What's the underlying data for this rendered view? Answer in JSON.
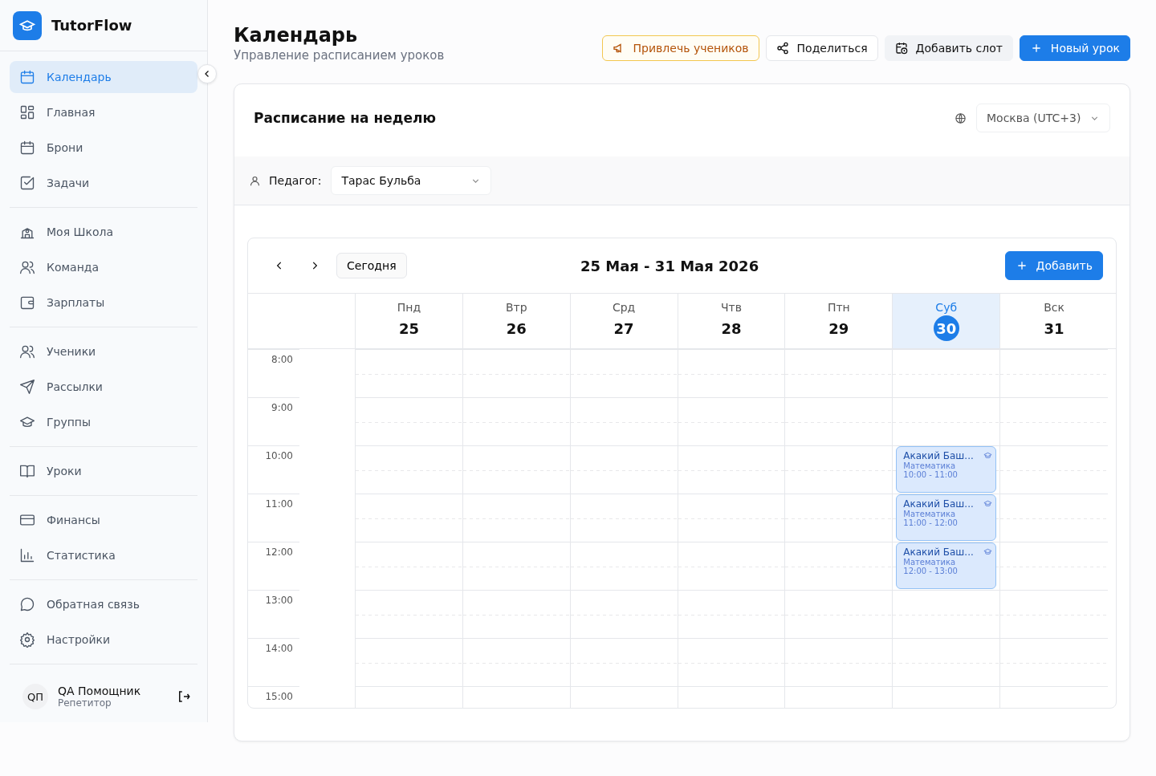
{
  "brand": {
    "name": "TutorFlow"
  },
  "sidebar": {
    "groups": [
      [
        {
          "label": "Календарь",
          "selected": true
        },
        {
          "label": "Главная",
          "selected": false
        },
        {
          "label": "Брони",
          "selected": false
        },
        {
          "label": "Задачи",
          "selected": false
        }
      ],
      [
        {
          "label": "Моя Школа",
          "selected": false
        },
        {
          "label": "Команда",
          "selected": false
        },
        {
          "label": "Зарплаты",
          "selected": false
        }
      ],
      [
        {
          "label": "Ученики",
          "selected": false
        },
        {
          "label": "Рассылки",
          "selected": false
        },
        {
          "label": "Группы",
          "selected": false
        }
      ],
      [
        {
          "label": "Уроки",
          "selected": false
        }
      ],
      [
        {
          "label": "Финансы",
          "selected": false
        },
        {
          "label": "Статистика",
          "selected": false
        }
      ],
      [
        {
          "label": "Обратная связь",
          "selected": false
        },
        {
          "label": "Настройки",
          "selected": false
        }
      ]
    ],
    "user": {
      "initials": "QП",
      "name": "QA Помощник",
      "role": "Репетитор"
    }
  },
  "header": {
    "title": "Календарь",
    "subtitle": "Управление расписанием уроков",
    "actions": [
      {
        "label": "Привлечь учеников",
        "kind": "promo"
      },
      {
        "label": "Поделиться",
        "kind": "share"
      },
      {
        "label": "Добавить слот",
        "kind": "slot"
      },
      {
        "label": "Новый урок",
        "kind": "primary"
      }
    ]
  },
  "schedule": {
    "title": "Расписание на неделю",
    "timezone": "Москва (UTC+3)",
    "teacher_label": "Педагог:",
    "teacher": "Тарас Бульба",
    "today_button": "Сегодня",
    "range": "25 Мая - 31 Мая 2026",
    "add_button": "Добавить",
    "days": [
      {
        "name": "Пнд",
        "date": "25",
        "selected": false
      },
      {
        "name": "Втр",
        "date": "26",
        "selected": false
      },
      {
        "name": "Срд",
        "date": "27",
        "selected": false
      },
      {
        "name": "Чтв",
        "date": "28",
        "selected": false
      },
      {
        "name": "Птн",
        "date": "29",
        "selected": false
      },
      {
        "name": "Суб",
        "date": "30",
        "selected": true
      },
      {
        "name": "Вск",
        "date": "31",
        "selected": false
      }
    ],
    "rows": [
      {
        "time": "8:00",
        "slots": [
          {
            "kind": "free"
          },
          {
            "kind": "free"
          },
          {
            "kind": "free"
          },
          {
            "kind": "free"
          },
          {
            "kind": "free"
          },
          {
            "kind": "free"
          },
          {
            "kind": "free"
          }
        ]
      },
      {
        "time": "9:00",
        "slots": [
          {
            "kind": "free"
          },
          {
            "kind": "free"
          },
          {
            "kind": "free"
          },
          {
            "kind": "free"
          },
          {
            "kind": "free"
          },
          {
            "kind": "free"
          },
          {
            "kind": "free"
          }
        ]
      },
      {
        "time": "10:00",
        "slots": [
          {
            "kind": "free"
          },
          {
            "kind": "free"
          },
          {
            "kind": "free"
          },
          {
            "kind": "free"
          },
          {
            "kind": "free"
          },
          {
            "kind": "lesson",
            "student": "Акакий Баш...",
            "subject": "Математика",
            "time": "10:00 - 11:00"
          },
          {
            "kind": "free"
          }
        ]
      },
      {
        "time": "11:00",
        "slots": [
          {
            "kind": "free"
          },
          {
            "kind": "free"
          },
          {
            "kind": "free"
          },
          {
            "kind": "free"
          },
          {
            "kind": "free"
          },
          {
            "kind": "lesson",
            "student": "Акакий Баш...",
            "subject": "Математика",
            "time": "11:00 - 12:00"
          },
          {
            "kind": "free"
          }
        ]
      },
      {
        "time": "12:00",
        "slots": [
          {
            "kind": "free"
          },
          {
            "kind": "free"
          },
          {
            "kind": "free"
          },
          {
            "kind": "free"
          },
          {
            "kind": "free"
          },
          {
            "kind": "lesson",
            "student": "Акакий Баш...",
            "subject": "Математика",
            "time": "12:00 - 13:00"
          },
          {
            "kind": "free"
          }
        ]
      },
      {
        "time": "13:00",
        "slots": [
          {
            "kind": "free"
          },
          {
            "kind": "free"
          },
          {
            "kind": "free"
          },
          {
            "kind": "free"
          },
          {
            "kind": "free"
          },
          {
            "kind": "free"
          },
          {
            "kind": "free"
          }
        ]
      },
      {
        "time": "14:00",
        "slots": [
          {
            "kind": "free"
          },
          {
            "kind": "free"
          },
          {
            "kind": "free"
          },
          {
            "kind": "free"
          },
          {
            "kind": "free"
          },
          {
            "kind": "free"
          },
          {
            "kind": "free"
          }
        ]
      },
      {
        "time": "15:00",
        "slots": [
          {
            "kind": "free"
          },
          {
            "kind": "free"
          },
          {
            "kind": "free"
          },
          {
            "kind": "free"
          },
          {
            "kind": "free"
          },
          {
            "kind": "free"
          },
          {
            "kind": "free"
          }
        ]
      }
    ]
  }
}
